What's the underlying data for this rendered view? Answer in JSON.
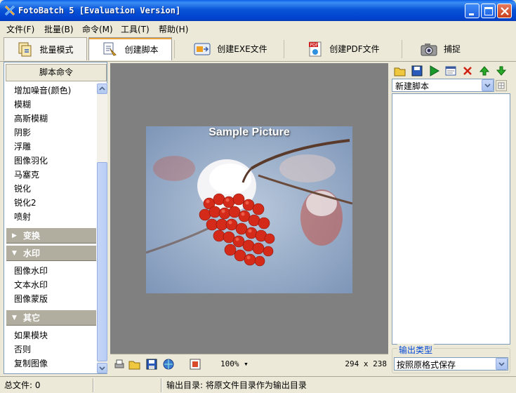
{
  "window": {
    "title": "FotoBatch 5 [Evaluation Version]"
  },
  "menu": [
    "文件(F)",
    "批量(B)",
    "命令(M)",
    "工具(T)",
    "帮助(H)"
  ],
  "tabs": [
    {
      "label": "批量模式",
      "icon": "batch-mode-icon"
    },
    {
      "label": "创建脚本",
      "icon": "create-script-icon"
    },
    {
      "label": "创建EXE文件",
      "icon": "create-exe-icon"
    },
    {
      "label": "创建PDF文件",
      "icon": "create-pdf-icon"
    },
    {
      "label": "捕捉",
      "icon": "camera-icon"
    }
  ],
  "left_panel": {
    "header": "脚本命令",
    "items_top": [
      "增加噪音(颜色)",
      "模糊",
      "高斯模糊",
      "阴影",
      "浮雕",
      "图像羽化",
      "马塞克",
      "锐化",
      "锐化2",
      "喷射"
    ],
    "group_transform": "变换",
    "group_watermark": "水印",
    "items_watermark": [
      "图像水印",
      "文本水印",
      "图像蒙版"
    ],
    "group_other": "其它",
    "items_other": [
      "如果模块",
      "否则",
      "复制图像"
    ]
  },
  "preview": {
    "caption": "Sample Picture",
    "zoom": "100%",
    "size": "294 x 238"
  },
  "right_panel": {
    "script_name": "新建脚本",
    "output_type_label": "输出类型",
    "output_type_value": "按照原格式保存"
  },
  "status": {
    "total_files": "总文件: 0",
    "output_dir": "输出目录: 将原文件目录作为输出目录"
  },
  "colors": {
    "title_bar": "#0A55D8",
    "preview_bg": "#808080",
    "group_header": "#B1AD9F",
    "accent_link": "#0046D5"
  }
}
